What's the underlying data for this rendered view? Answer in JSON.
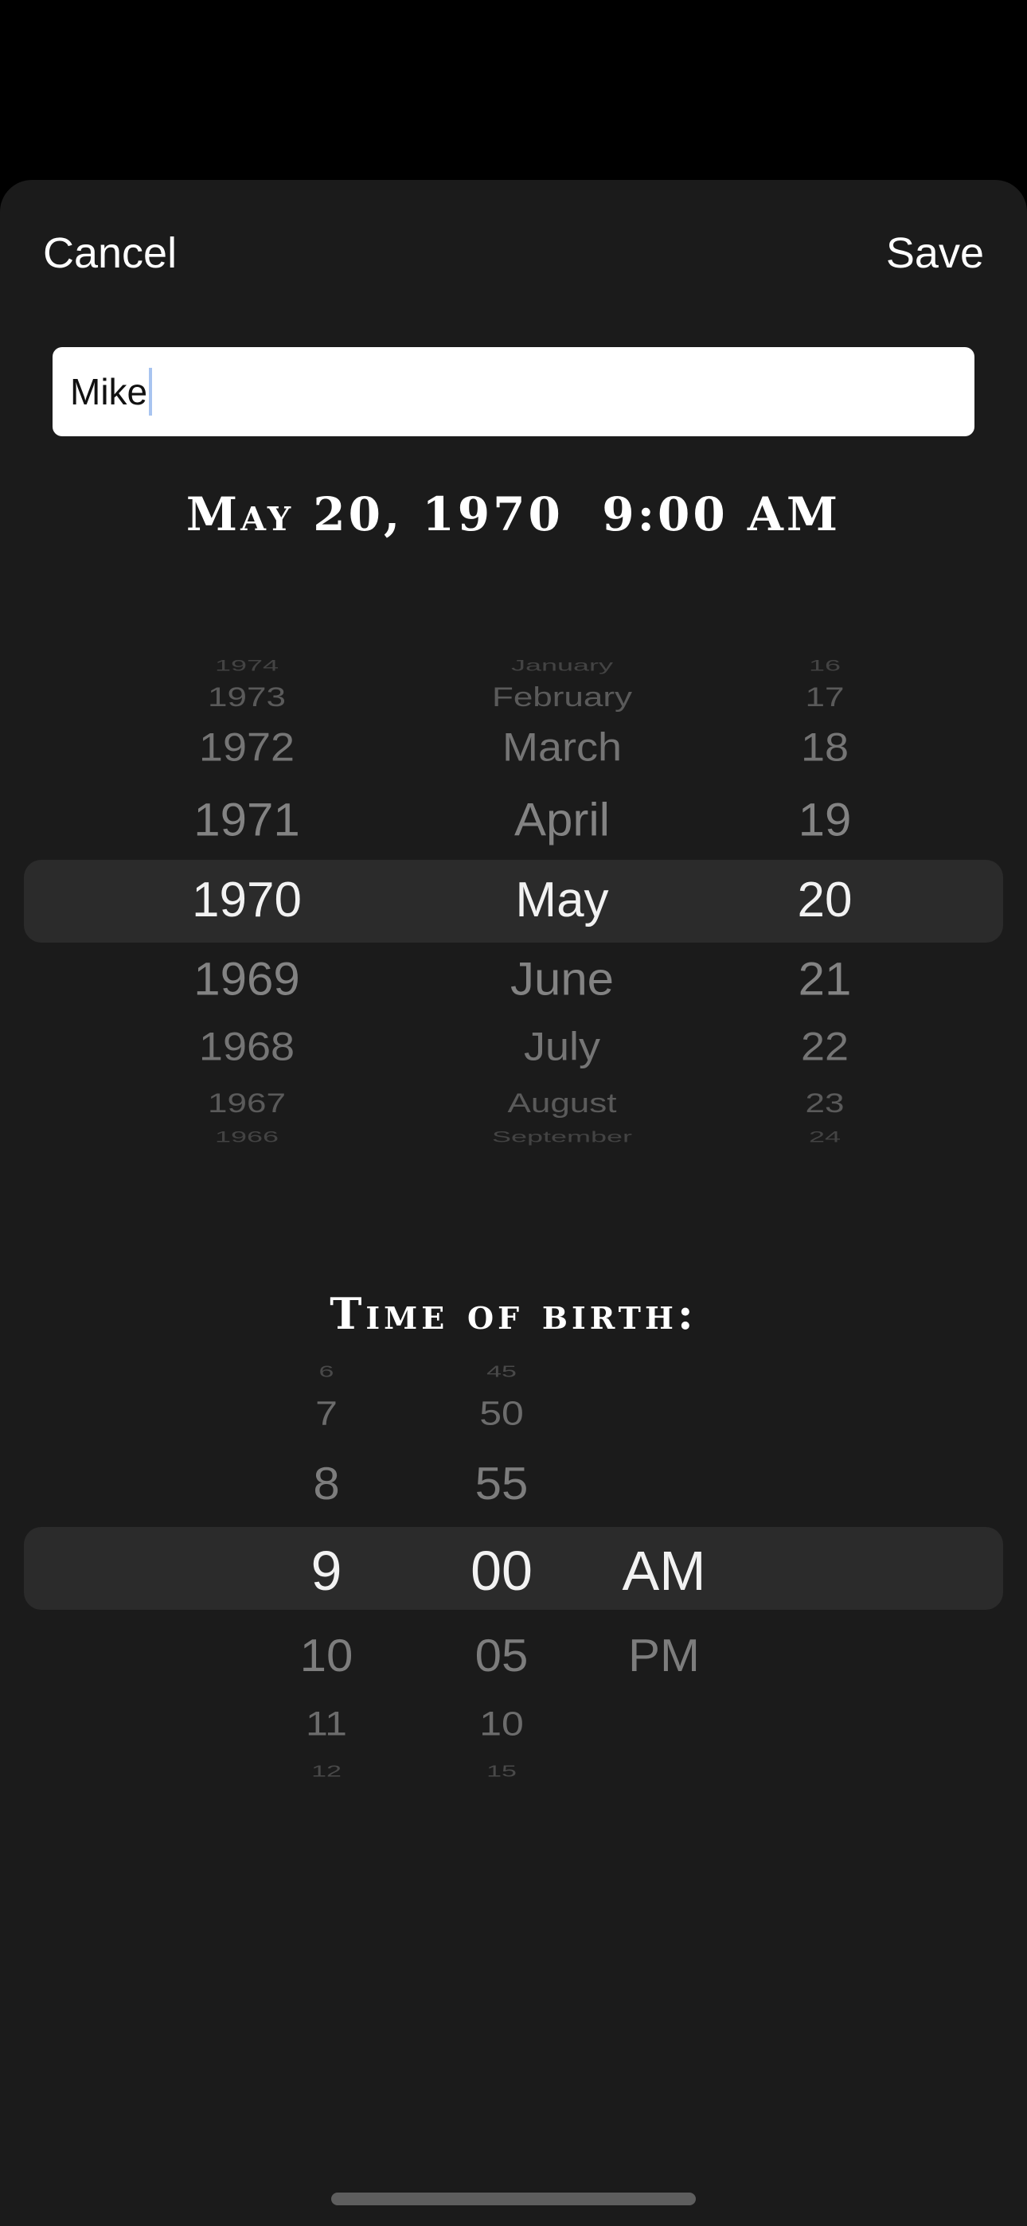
{
  "nav": {
    "cancel_label": "Cancel",
    "save_label": "Save"
  },
  "name_field": {
    "value": "Mike"
  },
  "summary": {
    "date_text": "May 20, 1970",
    "time_text": "9:00 AM"
  },
  "date_picker": {
    "years": [
      "1974",
      "1973",
      "1972",
      "1971",
      "1970",
      "1969",
      "1968",
      "1967",
      "1966"
    ],
    "months": [
      "January",
      "February",
      "March",
      "April",
      "May",
      "June",
      "July",
      "August",
      "September"
    ],
    "days": [
      "16",
      "17",
      "18",
      "19",
      "20",
      "21",
      "22",
      "23",
      "24"
    ],
    "selected": {
      "year": "1970",
      "month": "May",
      "day": "20"
    }
  },
  "time_section": {
    "label": "Time of birth:"
  },
  "time_picker": {
    "hours": [
      "6",
      "7",
      "8",
      "9",
      "10",
      "11",
      "12"
    ],
    "minutes": [
      "45",
      "50",
      "55",
      "00",
      "05",
      "10",
      "15"
    ],
    "periods": [
      "AM",
      "PM"
    ],
    "selected": {
      "hour": "9",
      "minute": "00",
      "period": "AM"
    }
  },
  "colors": {
    "sheet_bg": "#1b1b1b",
    "selection_band": "#2b2b2b",
    "selected_text": "#f2f2f2",
    "unselected_text": "#8f8f8f"
  }
}
